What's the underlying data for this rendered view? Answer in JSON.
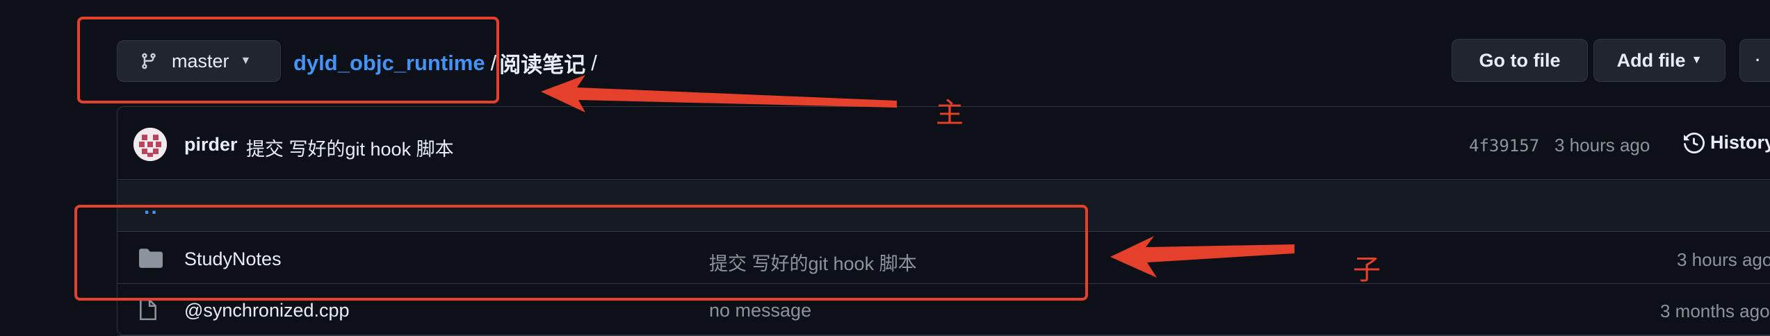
{
  "branch": {
    "name": "master"
  },
  "breadcrumb": {
    "repo": "dyld_objc_runtime",
    "separator": "/",
    "folder": "阅读笔记",
    "trailing_separator": "/"
  },
  "actions": {
    "go_to_file": "Go to file",
    "add_file": "Add file"
  },
  "latest_commit": {
    "author": "pirder",
    "message": "提交 写好的git hook 脚本",
    "hash": "4f39157",
    "time": "3 hours ago",
    "history_label": "History"
  },
  "parent_dir": {
    "label": ".."
  },
  "files": [
    {
      "type": "folder",
      "name": "StudyNotes",
      "message": "提交 写好的git hook 脚本",
      "time": "3 hours ago"
    },
    {
      "type": "file",
      "name": "@synchronized.cpp",
      "message": "no message",
      "time": "3 months ago"
    }
  ],
  "annotations": {
    "main_label": "主",
    "child_label": "子",
    "color": "#e5402b"
  },
  "colors": {
    "background": "#0d1117",
    "link": "#4493f8",
    "muted": "#8b949e",
    "border": "#30363d"
  }
}
